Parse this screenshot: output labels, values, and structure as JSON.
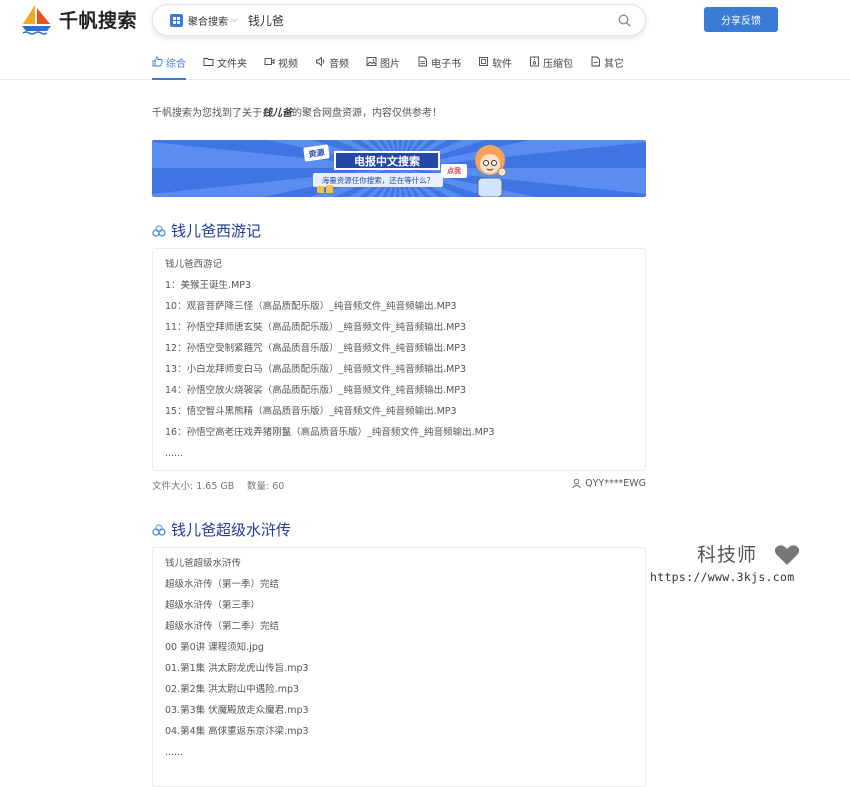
{
  "header": {
    "logo_text": "千帆搜索",
    "search": {
      "scope_label": "聚合搜索",
      "query": "钱儿爸"
    },
    "feedback_label": "分享反馈"
  },
  "tabs": [
    {
      "label": "综合",
      "icon": "thumb-icon",
      "active": true
    },
    {
      "label": "文件夹",
      "icon": "folder-icon"
    },
    {
      "label": "视频",
      "icon": "video-icon"
    },
    {
      "label": "音频",
      "icon": "audio-icon"
    },
    {
      "label": "图片",
      "icon": "image-icon"
    },
    {
      "label": "电子书",
      "icon": "ebook-icon"
    },
    {
      "label": "软件",
      "icon": "software-icon"
    },
    {
      "label": "压缩包",
      "icon": "archive-icon"
    },
    {
      "label": "其它",
      "icon": "other-icon"
    }
  ],
  "intro": {
    "prefix": "千帆搜索为您找到了关于",
    "keyword": "钱儿爸",
    "suffix": "的聚合网盘资源，内容仅供参考！"
  },
  "banner": {
    "tag": "资源",
    "title": "电报中文搜索",
    "subtitle": "海量资源任你搜索，还在等什么？",
    "click": "点我"
  },
  "results": [
    {
      "title": "钱儿爸西游记",
      "files": [
        "钱儿爸西游记",
        "1：美猴王诞生.MP3",
        "10：观音菩萨降三怪（高品质配乐版）_纯音频文件_纯音频输出.MP3",
        "11：孙悟空拜师唐玄奘（高品质配乐版）_纯音频文件_纯音频输出.MP3",
        "12：孙悟空受制紧箍咒（高品质音乐版）_纯音频文件_纯音频输出.MP3",
        "13：小白龙拜师变白马（高品质配乐版）_纯音频文件_纯音频输出.MP3",
        "14：孙悟空放火烧袈裟（高品质配乐版）_纯音频文件_纯音频输出.MP3",
        "15：悟空智斗黑熊精（高品质音乐版）_纯音频文件_纯音频输出.MP3",
        "16：孙悟空高老庄戏弄猪刚鬣（高品质音乐版）_纯音频文件_纯音频输出.MP3",
        "......"
      ],
      "size": "文件大小: 1.65 GB",
      "count": "数量: 60",
      "user": "QYY****EWG"
    },
    {
      "title": "钱儿爸超级水浒传",
      "files": [
        "钱儿爸超级水浒传",
        "超级水浒传（第一季）完结",
        "超级水浒传（第三季）",
        "超级水浒传（第二季）完结",
        "00 第0讲 课程须知.jpg",
        "01.第1集 洪太尉龙虎山传旨.mp3",
        "02.第2集 洪太尉山中遇险.mp3",
        "03.第3集 伏魔殿放走众魔君.mp3",
        "04.第4集 高俅重返东京汴梁.mp3",
        "......"
      ]
    }
  ],
  "watermark": {
    "cn": "科技师",
    "url": "https://www.3kjs.com"
  },
  "colors": {
    "accent": "#3a7bd5",
    "title": "#223a9a"
  }
}
